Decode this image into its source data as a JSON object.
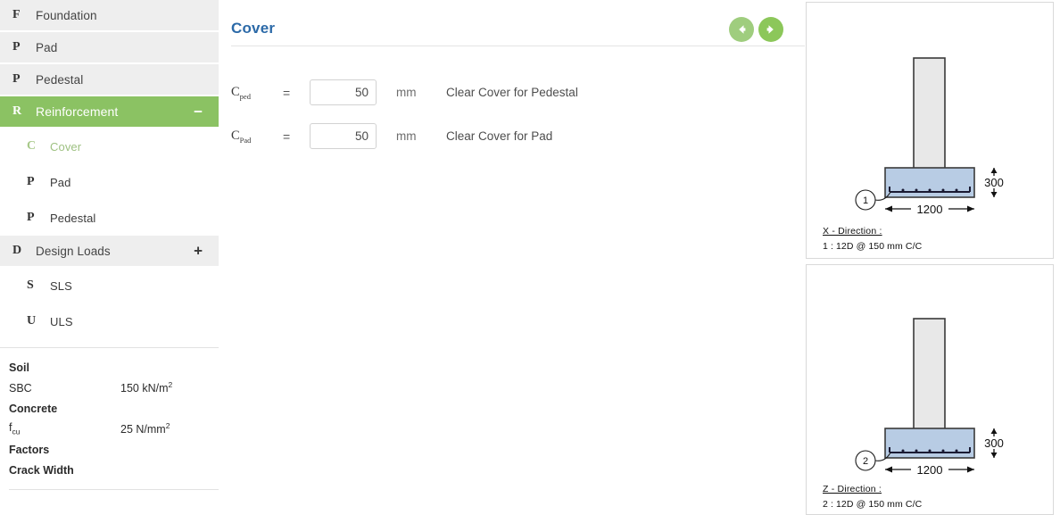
{
  "sidebar": {
    "nav": [
      {
        "glyph": "F",
        "label": "Foundation",
        "level": "top",
        "toggle": "",
        "selected": false
      },
      {
        "glyph": "P",
        "label": "Pad",
        "level": "top",
        "toggle": "",
        "selected": false
      },
      {
        "glyph": "P",
        "label": "Pedestal",
        "level": "top",
        "toggle": "",
        "selected": false
      },
      {
        "glyph": "R",
        "label": "Reinforcement",
        "level": "active",
        "toggle": "−",
        "selected": false
      },
      {
        "glyph": "C",
        "label": "Cover",
        "level": "sub",
        "toggle": "",
        "selected": true
      },
      {
        "glyph": "P",
        "label": "Pad",
        "level": "sub",
        "toggle": "",
        "selected": false
      },
      {
        "glyph": "P",
        "label": "Pedestal",
        "level": "sub",
        "toggle": "",
        "selected": false
      },
      {
        "glyph": "D",
        "label": "Design Loads",
        "level": "top",
        "toggle": "+",
        "selected": false
      },
      {
        "glyph": "S",
        "label": "SLS",
        "level": "sub",
        "toggle": "",
        "selected": false
      },
      {
        "glyph": "U",
        "label": "ULS",
        "level": "sub",
        "toggle": "",
        "selected": false
      }
    ],
    "properties": [
      {
        "key": "Soil",
        "bold": true,
        "value": ""
      },
      {
        "key": "SBC",
        "bold": false,
        "value": "150 kN/m",
        "sup": "2"
      },
      {
        "key": "Concrete",
        "bold": true,
        "value": ""
      },
      {
        "key": "fcu",
        "key_base": "f",
        "key_sub": "cu",
        "bold": false,
        "value": "25 N/mm",
        "sup": "2"
      },
      {
        "key": "Factors",
        "bold": true,
        "value": ""
      },
      {
        "key": "Crack Width",
        "bold": true,
        "value": ""
      }
    ]
  },
  "main": {
    "title": "Cover",
    "prev_arrow_label": "Previous",
    "next_arrow_label": "Next",
    "rows": [
      {
        "symbol_base": "C",
        "symbol_sub": "ped",
        "equals": "=",
        "value": "50",
        "unit": "mm",
        "description": "Clear Cover for Pedestal"
      },
      {
        "symbol_base": "C",
        "symbol_sub": "Pad",
        "equals": "=",
        "value": "50",
        "unit": "mm",
        "description": "Clear Cover for Pad"
      }
    ]
  },
  "diagrams": [
    {
      "mark": "1",
      "width_dim": "1200",
      "depth_dim": "300",
      "legend_title": "X - Direction :",
      "legend_line": "1  : 12D @ 150 mm C/C",
      "pad_color": "#b8cce4",
      "pedestal_color": "#e8e8e8"
    },
    {
      "mark": "2",
      "width_dim": "1200",
      "depth_dim": "300",
      "legend_title": "Z - Direction :",
      "legend_line": "2  : 12D @ 150 mm C/C",
      "pad_color": "#b8cce4",
      "pedestal_color": "#e8e8e8"
    }
  ],
  "colors": {
    "accent_green": "#8bc263",
    "title_blue": "#2c6aa8",
    "pad_blue": "#b8cce4"
  }
}
